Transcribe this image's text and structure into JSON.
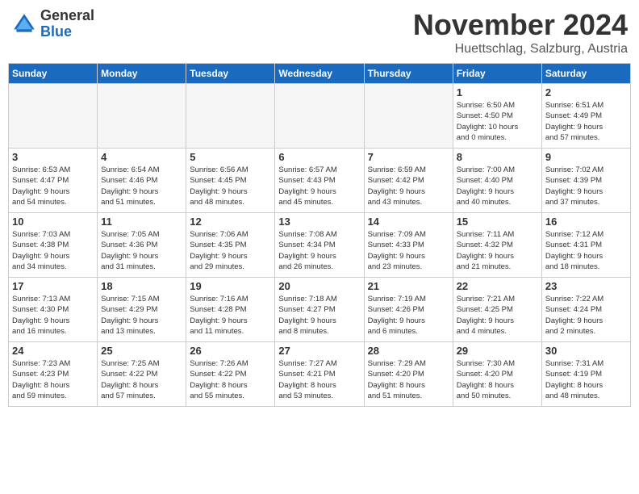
{
  "header": {
    "logo_general": "General",
    "logo_blue": "Blue",
    "month_title": "November 2024",
    "location": "Huettschlag, Salzburg, Austria"
  },
  "weekdays": [
    "Sunday",
    "Monday",
    "Tuesday",
    "Wednesday",
    "Thursday",
    "Friday",
    "Saturday"
  ],
  "weeks": [
    [
      {
        "day": "",
        "info": ""
      },
      {
        "day": "",
        "info": ""
      },
      {
        "day": "",
        "info": ""
      },
      {
        "day": "",
        "info": ""
      },
      {
        "day": "",
        "info": ""
      },
      {
        "day": "1",
        "info": "Sunrise: 6:50 AM\nSunset: 4:50 PM\nDaylight: 10 hours\nand 0 minutes."
      },
      {
        "day": "2",
        "info": "Sunrise: 6:51 AM\nSunset: 4:49 PM\nDaylight: 9 hours\nand 57 minutes."
      }
    ],
    [
      {
        "day": "3",
        "info": "Sunrise: 6:53 AM\nSunset: 4:47 PM\nDaylight: 9 hours\nand 54 minutes."
      },
      {
        "day": "4",
        "info": "Sunrise: 6:54 AM\nSunset: 4:46 PM\nDaylight: 9 hours\nand 51 minutes."
      },
      {
        "day": "5",
        "info": "Sunrise: 6:56 AM\nSunset: 4:45 PM\nDaylight: 9 hours\nand 48 minutes."
      },
      {
        "day": "6",
        "info": "Sunrise: 6:57 AM\nSunset: 4:43 PM\nDaylight: 9 hours\nand 45 minutes."
      },
      {
        "day": "7",
        "info": "Sunrise: 6:59 AM\nSunset: 4:42 PM\nDaylight: 9 hours\nand 43 minutes."
      },
      {
        "day": "8",
        "info": "Sunrise: 7:00 AM\nSunset: 4:40 PM\nDaylight: 9 hours\nand 40 minutes."
      },
      {
        "day": "9",
        "info": "Sunrise: 7:02 AM\nSunset: 4:39 PM\nDaylight: 9 hours\nand 37 minutes."
      }
    ],
    [
      {
        "day": "10",
        "info": "Sunrise: 7:03 AM\nSunset: 4:38 PM\nDaylight: 9 hours\nand 34 minutes."
      },
      {
        "day": "11",
        "info": "Sunrise: 7:05 AM\nSunset: 4:36 PM\nDaylight: 9 hours\nand 31 minutes."
      },
      {
        "day": "12",
        "info": "Sunrise: 7:06 AM\nSunset: 4:35 PM\nDaylight: 9 hours\nand 29 minutes."
      },
      {
        "day": "13",
        "info": "Sunrise: 7:08 AM\nSunset: 4:34 PM\nDaylight: 9 hours\nand 26 minutes."
      },
      {
        "day": "14",
        "info": "Sunrise: 7:09 AM\nSunset: 4:33 PM\nDaylight: 9 hours\nand 23 minutes."
      },
      {
        "day": "15",
        "info": "Sunrise: 7:11 AM\nSunset: 4:32 PM\nDaylight: 9 hours\nand 21 minutes."
      },
      {
        "day": "16",
        "info": "Sunrise: 7:12 AM\nSunset: 4:31 PM\nDaylight: 9 hours\nand 18 minutes."
      }
    ],
    [
      {
        "day": "17",
        "info": "Sunrise: 7:13 AM\nSunset: 4:30 PM\nDaylight: 9 hours\nand 16 minutes."
      },
      {
        "day": "18",
        "info": "Sunrise: 7:15 AM\nSunset: 4:29 PM\nDaylight: 9 hours\nand 13 minutes."
      },
      {
        "day": "19",
        "info": "Sunrise: 7:16 AM\nSunset: 4:28 PM\nDaylight: 9 hours\nand 11 minutes."
      },
      {
        "day": "20",
        "info": "Sunrise: 7:18 AM\nSunset: 4:27 PM\nDaylight: 9 hours\nand 8 minutes."
      },
      {
        "day": "21",
        "info": "Sunrise: 7:19 AM\nSunset: 4:26 PM\nDaylight: 9 hours\nand 6 minutes."
      },
      {
        "day": "22",
        "info": "Sunrise: 7:21 AM\nSunset: 4:25 PM\nDaylight: 9 hours\nand 4 minutes."
      },
      {
        "day": "23",
        "info": "Sunrise: 7:22 AM\nSunset: 4:24 PM\nDaylight: 9 hours\nand 2 minutes."
      }
    ],
    [
      {
        "day": "24",
        "info": "Sunrise: 7:23 AM\nSunset: 4:23 PM\nDaylight: 8 hours\nand 59 minutes."
      },
      {
        "day": "25",
        "info": "Sunrise: 7:25 AM\nSunset: 4:22 PM\nDaylight: 8 hours\nand 57 minutes."
      },
      {
        "day": "26",
        "info": "Sunrise: 7:26 AM\nSunset: 4:22 PM\nDaylight: 8 hours\nand 55 minutes."
      },
      {
        "day": "27",
        "info": "Sunrise: 7:27 AM\nSunset: 4:21 PM\nDaylight: 8 hours\nand 53 minutes."
      },
      {
        "day": "28",
        "info": "Sunrise: 7:29 AM\nSunset: 4:20 PM\nDaylight: 8 hours\nand 51 minutes."
      },
      {
        "day": "29",
        "info": "Sunrise: 7:30 AM\nSunset: 4:20 PM\nDaylight: 8 hours\nand 50 minutes."
      },
      {
        "day": "30",
        "info": "Sunrise: 7:31 AM\nSunset: 4:19 PM\nDaylight: 8 hours\nand 48 minutes."
      }
    ]
  ]
}
